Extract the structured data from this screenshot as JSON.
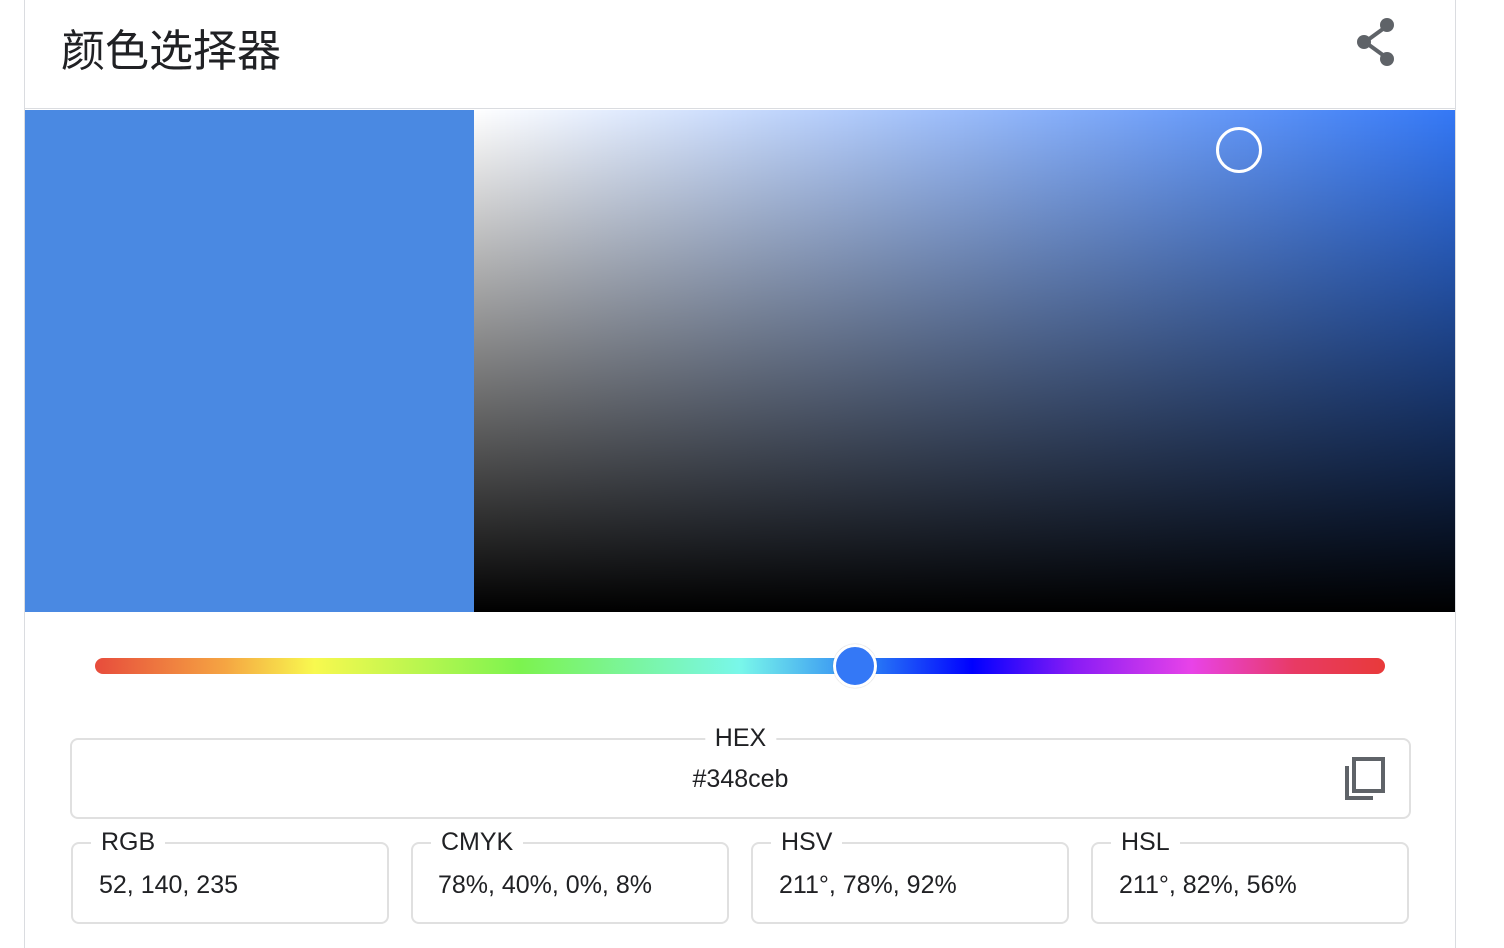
{
  "header": {
    "title": "颜色选择器",
    "share_icon": "share-icon"
  },
  "colors": {
    "selected": "#4a89e2",
    "hue_pure": "#3478f6",
    "hue_handle": "#3478f6"
  },
  "picker": {
    "saturation": 0.78,
    "value": 0.92,
    "hue_position": 0.589
  },
  "hex": {
    "label": "HEX",
    "value": "#348ceb",
    "copy_icon": "copy-icon"
  },
  "formats": [
    {
      "label": "RGB",
      "value": "52, 140, 235"
    },
    {
      "label": "CMYK",
      "value": " 78%, 40%, 0%, 8%"
    },
    {
      "label": "HSV",
      "value": "211°, 78%, 92%"
    },
    {
      "label": "HSL",
      "value": "211°, 82%, 56%"
    }
  ]
}
